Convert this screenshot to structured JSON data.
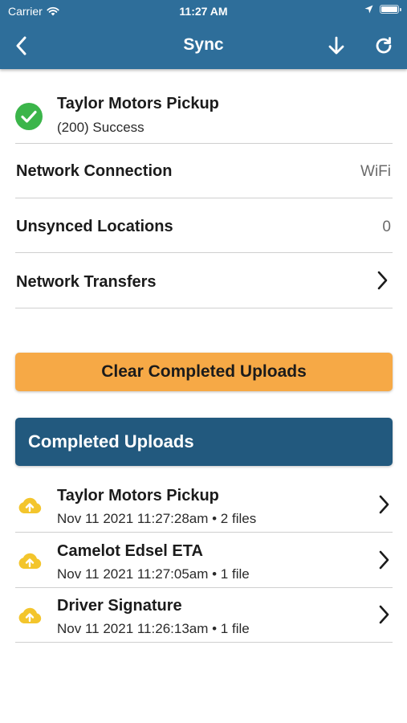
{
  "status_bar": {
    "carrier": "Carrier",
    "time": "11:27 AM"
  },
  "nav": {
    "title": "Sync"
  },
  "sync_status": {
    "title": "Taylor Motors Pickup",
    "subtitle": "(200) Success"
  },
  "info_rows": {
    "network_connection": {
      "label": "Network Connection",
      "value": "WiFi"
    },
    "unsynced_locations": {
      "label": "Unsynced Locations",
      "value": "0"
    },
    "network_transfers": {
      "label": "Network Transfers"
    }
  },
  "clear_button": {
    "label": "Clear Completed Uploads"
  },
  "completed_section": {
    "title": "Completed Uploads"
  },
  "uploads": [
    {
      "title": "Taylor Motors Pickup",
      "meta": "Nov 11 2021 11:27:28am • 2 files"
    },
    {
      "title": "Camelot Edsel ETA",
      "meta": "Nov 11 2021 11:27:05am • 1 file"
    },
    {
      "title": "Driver Signature",
      "meta": "Nov 11 2021 11:26:13am • 1 file"
    }
  ],
  "colors": {
    "header": "#2e6e9a",
    "section_header": "#22597e",
    "clear_button": "#f6a946",
    "success": "#3bb54a",
    "upload_icon": "#f3c52c"
  },
  "icons": {
    "back": "chevron-left-icon",
    "download": "arrow-down-icon",
    "refresh": "refresh-icon",
    "success": "check-circle-icon",
    "upload": "cloud-upload-icon",
    "disclosure": "chevron-right-icon"
  }
}
